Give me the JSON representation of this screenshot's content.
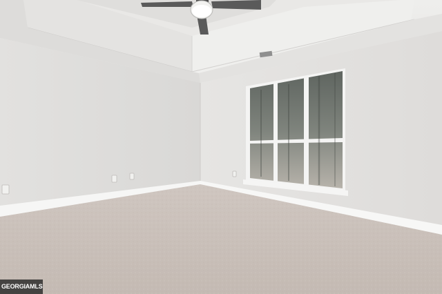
{
  "watermark": {
    "text": "GEORGIAMLS"
  }
}
